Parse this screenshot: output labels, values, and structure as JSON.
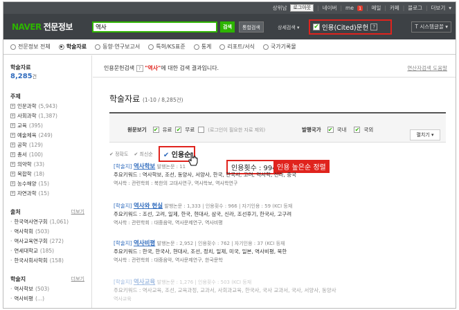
{
  "util": {
    "links": [
      "상위남",
      "로그아웃",
      "네이버",
      "me",
      "메일",
      "카페",
      "블로그",
      "더보기"
    ],
    "me_badge": "1"
  },
  "header": {
    "logo": "NAVER",
    "service": "전문정보",
    "search_value": "역사",
    "search_btn": "검색",
    "integrated_btn": "통합검색",
    "detail": "상세검색",
    "cited_label": "인용(Cited)문헌",
    "cited_help": "?",
    "sysfont": "T 시스템글꼴"
  },
  "tabs": [
    "전문정보 전체",
    "학술자료",
    "동향·연구보고서",
    "특허/KS표준",
    "통계",
    "리포트/서식",
    "국가기록물"
  ],
  "sidebar": {
    "title": "학술자료",
    "count": "8,285",
    "count_unit": "건",
    "subject_title": "주제",
    "subjects": [
      {
        "name": "인문과학",
        "n": "(5,943)"
      },
      {
        "name": "사회과학",
        "n": "(1,387)"
      },
      {
        "name": "교육",
        "n": "(395)"
      },
      {
        "name": "예술체육",
        "n": "(249)"
      },
      {
        "name": "공학",
        "n": "(129)"
      },
      {
        "name": "총서",
        "n": "(100)"
      },
      {
        "name": "의약학",
        "n": "(33)"
      },
      {
        "name": "복합학",
        "n": "(18)"
      },
      {
        "name": "농수해양",
        "n": "(15)"
      },
      {
        "name": "자연과학",
        "n": "(15)"
      }
    ],
    "pub_title": "출처",
    "pub_more": "더보기",
    "pubs": [
      {
        "name": "한국역사연구회",
        "n": "(1,061)"
      },
      {
        "name": "역사학회",
        "n": "(503)"
      },
      {
        "name": "역사교육연구회",
        "n": "(272)"
      },
      {
        "name": "연세대학교",
        "n": "(185)"
      },
      {
        "name": "한국사회사학회",
        "n": "(158)"
      }
    ],
    "journal_title": "학술지",
    "journal_more": "더보기",
    "journals": [
      {
        "name": "역사학보",
        "n": "(503)"
      },
      {
        "name": "역사비평",
        "n": "(...)"
      }
    ]
  },
  "main": {
    "result_prefix": "인용문헌검색",
    "result_help": "?",
    "query": "\"역사\"",
    "result_suffix": "에 대한 검색 결과입니다.",
    "guide": "연산자검색 도움말",
    "section_title": "학술자료",
    "section_range": "(1-10 / 8,285건)",
    "filter": {
      "label1": "원문보기",
      "paid": "유료",
      "free": "무료",
      "login_only": "로그인이 필요한 자료 제외",
      "label2": "발행국가",
      "domestic": "국내",
      "foreign": "국외",
      "expand": "펼치기"
    },
    "sort": [
      "정확도",
      "최신순",
      "인용순"
    ],
    "callout_count": "인용횟수 : 994",
    "callout_sort": "인용 높은순 정렬",
    "items": [
      {
        "tag": "[학술지]",
        "title": "역사학보",
        "meta": "발행논문 : 11",
        "kw": "주요키워드 : 역사학보, 조선, 동양사, 서양사, 한국, 한국사, 고려, 역사학, 신라, 중국",
        "rel": "역사학 : 관련학회 : 북한의 고대사연구, 역사학보, 역사학연구"
      },
      {
        "tag": "[학술지]",
        "title": "역사와 현실",
        "meta": "발행논문 : 1,333 | 인용횟수 : 966 | 자기인용 : 59 (KCI 등재",
        "kw": "주요키워드 : 조선, 고려, 일제, 한국, 현대사, 삼국, 신라, 조선후기, 한국사, 고구려",
        "rel": "역사학 : 관련학회 : 대중음악, 역사문제연구, 역사비평"
      },
      {
        "tag": "[학술지]",
        "title": "역사비평",
        "meta": "발행논문 : 2,952 | 인용횟수 : 762 | 자기인용 : 37 (KCI 등재",
        "kw": "주요키워드 : 한국, 한국사, 현대사, 조선, 정치, 일제, 미국, 일본, 역사비평, 북한",
        "rel": "역사학 : 관련학회 : 대중음악, 역사문제연구, 한국문학"
      },
      {
        "tag": "[학술지]",
        "title": "역사교육",
        "meta": "발행논문 : 1,276 | 인용횟수 : 503 (KCI 등재",
        "kw": "주요키워드 : 역사교육, 조선, 교육과정, 교과서, 사회과교육, 한국사, 국사 교과서, 국사, 서양사, 동양사",
        "rel": "역사교육"
      }
    ]
  }
}
